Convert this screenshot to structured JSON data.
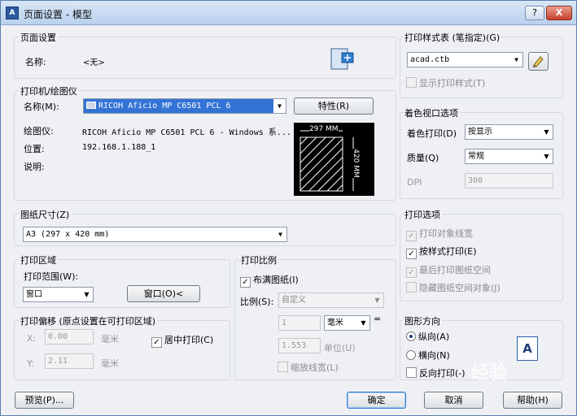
{
  "window": {
    "title": "页面设置 - 模型",
    "help_label": "?",
    "close_label": "X",
    "app_icon_label": "A"
  },
  "page_setup": {
    "legend": "页面设置",
    "name_label": "名称:",
    "name_value": "<无>",
    "dwg_icon": "dwg-file-icon"
  },
  "printer": {
    "legend": "打印机/绘图仪",
    "name_label": "名称(M):",
    "name_value": "RICOH Aficio MP C6501 PCL 6",
    "properties_button": "特性(R)",
    "plotter_label": "绘图仪:",
    "plotter_value": "RICOH Aficio MP C6501 PCL 6 - Windows 系...",
    "location_label": "位置:",
    "location_value": "192.168.1.188_1",
    "description_label": "说明:",
    "preview_width": "297 MM",
    "preview_height": "420 MM"
  },
  "paper_size": {
    "legend": "图纸尺寸(Z)",
    "value": "A3 (297 x 420 mm)"
  },
  "plot_area": {
    "legend": "打印区域",
    "range_label": "打印范围(W):",
    "range_value": "窗口",
    "window_button": "窗口(O)<"
  },
  "plot_offset": {
    "legend": "打印偏移 (原点设置在可打印区域)",
    "x_label": "X:",
    "x_value": "0.00",
    "x_unit": "毫米",
    "y_label": "Y:",
    "y_value": "2.11",
    "y_unit": "毫米",
    "center_label": "居中打印(C)"
  },
  "plot_scale": {
    "legend": "打印比例",
    "fit_label": "布满图纸(I)",
    "scale_label": "比例(S):",
    "scale_value": "自定义",
    "value1": "1",
    "unit_value": "毫米",
    "equals": "=",
    "value2": "1.553",
    "unit_label": "单位(U)",
    "lineweights_label": "缩放线宽(L)"
  },
  "style_table": {
    "legend": "打印样式表 (笔指定)(G)",
    "value": "acad.ctb",
    "display_label": "显示打印样式(T)"
  },
  "shaded_viewport": {
    "legend": "着色视口选项",
    "shade_label": "着色打印(D)",
    "shade_value": "按显示",
    "quality_label": "质量(Q)",
    "quality_value": "常规",
    "dpi_label": "DPI",
    "dpi_value": "300"
  },
  "plot_options": {
    "legend": "打印选项",
    "items": [
      {
        "label": "打印对象线宽",
        "checked": true,
        "enabled": false
      },
      {
        "label": "按样式打印(E)",
        "checked": true,
        "enabled": true
      },
      {
        "label": "最后打印图纸空间",
        "checked": true,
        "enabled": false
      },
      {
        "label": "隐藏图纸空间对象(J)",
        "checked": false,
        "enabled": false
      }
    ]
  },
  "orientation": {
    "legend": "图形方向",
    "portrait": "纵向(A)",
    "landscape": "横向(N)",
    "upside_down": "反向打印(-)",
    "icon_letter": "A"
  },
  "footer": {
    "preview": "预览(P)...",
    "ok": "确定",
    "cancel": "取消",
    "help": "帮助(H)"
  },
  "watermark": "经验"
}
